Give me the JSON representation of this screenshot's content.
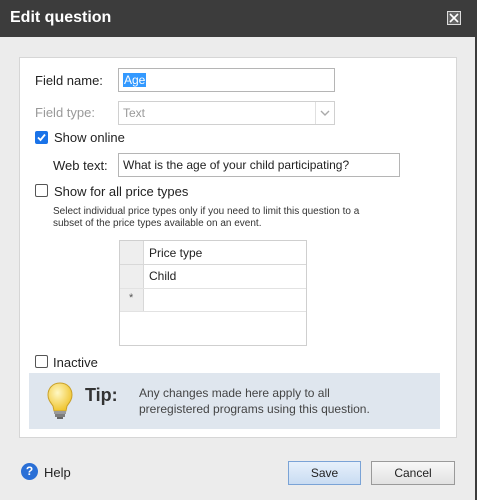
{
  "dialog": {
    "title": "Edit question",
    "close_icon": "close-icon"
  },
  "form": {
    "field_name_label": "Field name:",
    "field_name_value": "Age",
    "field_type_label": "Field type:",
    "field_type_value": "Text",
    "show_online_label": "Show online",
    "show_online_checked": true,
    "web_text_label": "Web text:",
    "web_text_value": "What is the age of your child participating?",
    "show_all_price_types_label": "Show for all price types",
    "show_all_price_types_checked": false,
    "price_types_note_line1": "Select individual price types only if you need to limit this question to a",
    "price_types_note_line2": "subset of the price types available on an event.",
    "price_grid": {
      "header": "Price type",
      "rows": [
        "Child"
      ],
      "new_row_marker": "*"
    },
    "inactive_label": "Inactive",
    "inactive_checked": false
  },
  "tip": {
    "icon": "lightbulb-icon",
    "title": "Tip:",
    "line1": "Any changes made here apply to all",
    "line2": "preregistered programs using this question."
  },
  "footer": {
    "help_label": "Help",
    "save_label": "Save",
    "cancel_label": "Cancel"
  },
  "colors": {
    "titlebar": "#3c3c3c",
    "accent": "#1a73e8",
    "tip_bg": "#dfe6ee"
  }
}
